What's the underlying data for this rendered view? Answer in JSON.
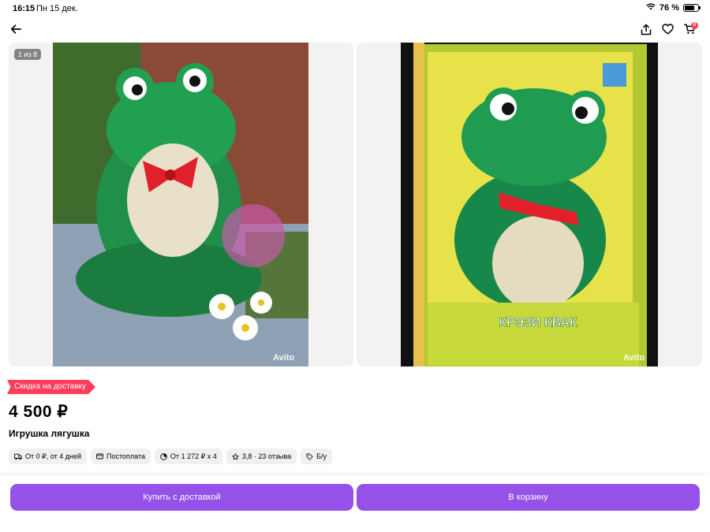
{
  "status_bar": {
    "time": "16:15",
    "date": "Пн 15 дек.",
    "battery": "76 %",
    "battery_level": 0.76
  },
  "gallery": {
    "counter": "1 из 8",
    "photos": [
      {
        "icon": "frog-toy-photo",
        "watermark": "Avito"
      },
      {
        "icon": "frog-toy-box-photo",
        "watermark": "Avito",
        "box_text": "КРЭЗИ КВАК"
      }
    ]
  },
  "cart": {
    "badge": "0"
  },
  "listing": {
    "promo_badge": "Скидка на доставку",
    "price": "4 500 ₽",
    "title": "Игрушка лягушка"
  },
  "chips": [
    {
      "icon": "truck-icon",
      "label": "От 0 ₽, от 4 дней"
    },
    {
      "icon": "wallet-icon",
      "label": "Постоплата"
    },
    {
      "icon": "installment-icon",
      "label": "От 1 272 ₽ х 4"
    },
    {
      "icon": "star-icon",
      "label": "3,8 · 23 отзыва"
    },
    {
      "icon": "tag-icon",
      "label": "Б/у"
    }
  ],
  "actions": {
    "buy_label": "Купить с доставкой",
    "cart_label": "В корзину"
  }
}
